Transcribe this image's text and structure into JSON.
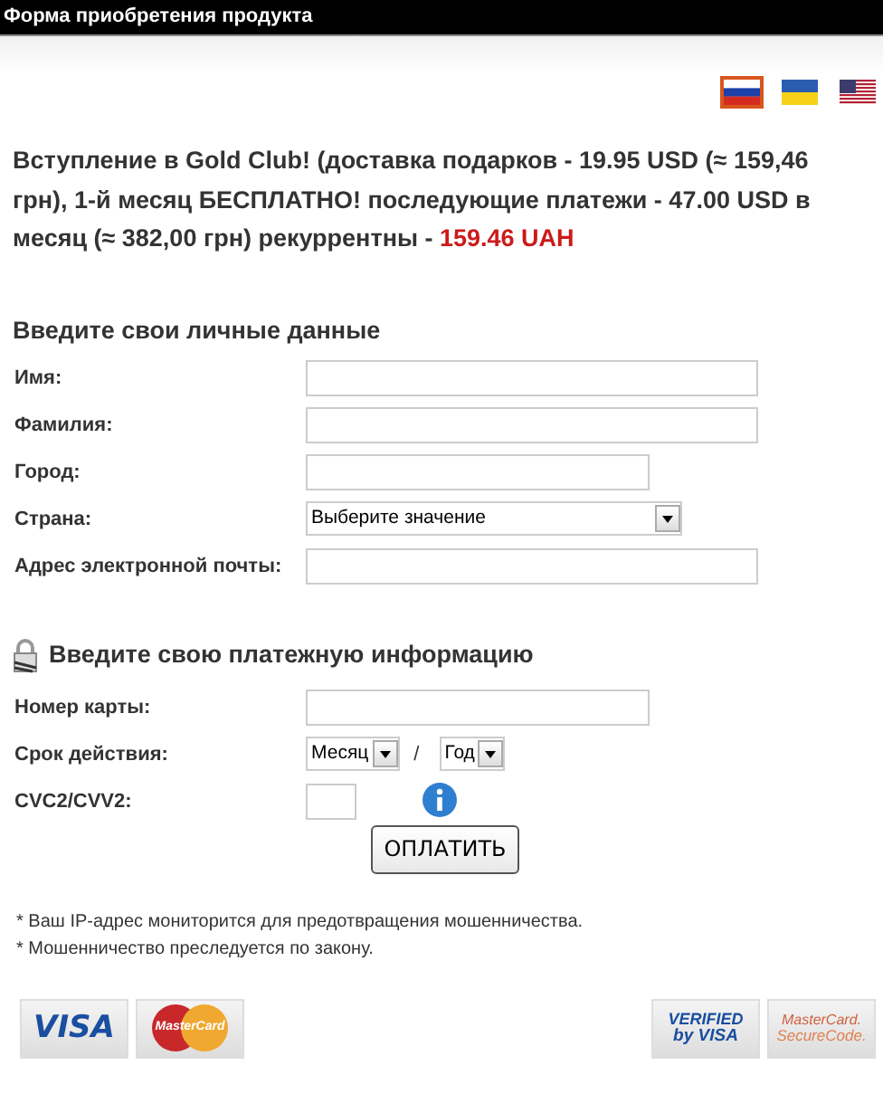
{
  "window": {
    "title": "Форма приобретения продукта"
  },
  "languages": [
    {
      "kind": "ru",
      "selected": true
    },
    {
      "kind": "ua",
      "selected": false
    },
    {
      "kind": "us",
      "selected": false
    }
  ],
  "offer": {
    "text": "Вступление в Gold Club! (доставка подарков - 19.95 USD (≈ 159,46 грн), 1-й месяц БЕСПЛАТНО! последующие платежи - 47.00 USD в месяц (≈ 382,00 грн) рекуррентны - ",
    "price": "159.46 UAH"
  },
  "personal": {
    "heading": "Введите свои личные данные",
    "fields": [
      {
        "label": "Имя:",
        "kind": "long"
      },
      {
        "label": "Фамилия:",
        "kind": "long"
      },
      {
        "label": "Город:",
        "kind": "short"
      },
      {
        "label": "Страна:",
        "kind": "select",
        "value": "Выберите значение"
      },
      {
        "label": "Адрес электронной почты:",
        "kind": "long"
      }
    ]
  },
  "payment": {
    "heading": "Введите свою платежную информацию",
    "card_label": "Номер карты:",
    "expiry_label": "Срок действия:",
    "month": "Месяц",
    "separator": "/",
    "year": "Год",
    "cvc_label": "CVC2/CVV2:"
  },
  "submit": "ОПЛАТИТЬ",
  "notes": [
    "* Ваш IP-адрес мониторится для предотвращения мошенничества.",
    "* Мошенничество преследуется по закону."
  ],
  "logos": [
    {
      "kind": "visa",
      "text": "VISA"
    },
    {
      "kind": "mastercard",
      "text": "MasterCard"
    },
    {
      "kind": "verified",
      "text": "VERIFIED",
      "sub": "by VISA"
    },
    {
      "kind": "securecode",
      "text": "MasterCard.",
      "sub": "SecureCode."
    }
  ]
}
